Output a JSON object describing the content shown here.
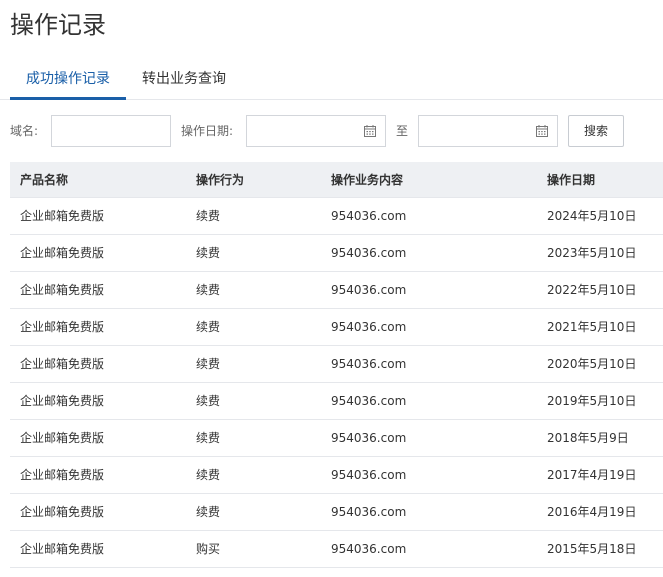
{
  "page": {
    "title": "操作记录"
  },
  "tabs": [
    {
      "label": "成功操作记录",
      "active": true
    },
    {
      "label": "转出业务查询",
      "active": false
    }
  ],
  "filters": {
    "domain_label": "域名:",
    "domain_value": "",
    "date_label": "操作日期:",
    "date_from": "",
    "to_label": "至",
    "date_to": "",
    "search_label": "搜索"
  },
  "table": {
    "columns": [
      "产品名称",
      "操作行为",
      "操作业务内容",
      "操作日期"
    ],
    "rows": [
      [
        "企业邮箱免费版",
        "续费",
        "954036.com",
        "2024年5月10日"
      ],
      [
        "企业邮箱免费版",
        "续费",
        "954036.com",
        "2023年5月10日"
      ],
      [
        "企业邮箱免费版",
        "续费",
        "954036.com",
        "2022年5月10日"
      ],
      [
        "企业邮箱免费版",
        "续费",
        "954036.com",
        "2021年5月10日"
      ],
      [
        "企业邮箱免费版",
        "续费",
        "954036.com",
        "2020年5月10日"
      ],
      [
        "企业邮箱免费版",
        "续费",
        "954036.com",
        "2019年5月10日"
      ],
      [
        "企业邮箱免费版",
        "续费",
        "954036.com",
        "2018年5月9日"
      ],
      [
        "企业邮箱免费版",
        "续费",
        "954036.com",
        "2017年4月19日"
      ],
      [
        "企业邮箱免费版",
        "续费",
        "954036.com",
        "2016年4月19日"
      ],
      [
        "企业邮箱免费版",
        "购买",
        "954036.com",
        "2015年5月18日"
      ]
    ]
  },
  "colors": {
    "accent": "#1a5fa8",
    "header_bg": "#eef0f3",
    "border": "#e5e7eb"
  }
}
